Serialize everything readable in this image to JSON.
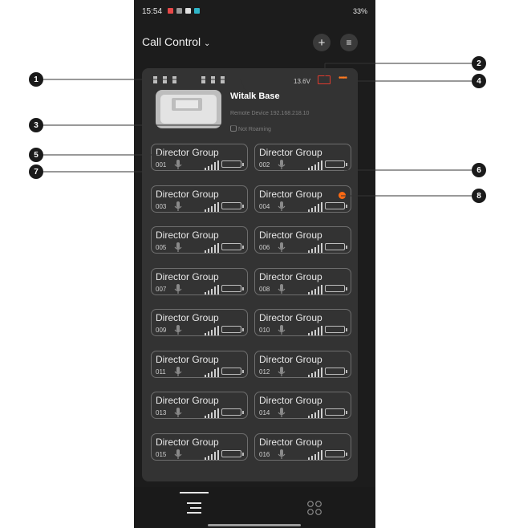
{
  "status_bar": {
    "time": "15:54",
    "right_text": "33%"
  },
  "header": {
    "title": "Call Control",
    "chevron": "chevron-down-icon",
    "add_icon": "plus-icon",
    "menu_icon": "menu-icon"
  },
  "base": {
    "voltage": "13.6V",
    "name": "Witalk Base",
    "remote_device": "Remote Device 192.168.218.10",
    "roaming": "Not Roaming",
    "more_dots": "••••"
  },
  "groups": [
    {
      "title": "Director Group",
      "num": "001"
    },
    {
      "title": "Director Group",
      "num": "002"
    },
    {
      "title": "Director Group",
      "num": "003"
    },
    {
      "title": "Director Group",
      "num": "004"
    },
    {
      "title": "Director Group",
      "num": "005"
    },
    {
      "title": "Director Group",
      "num": "006"
    },
    {
      "title": "Director Group",
      "num": "007"
    },
    {
      "title": "Director Group",
      "num": "008"
    },
    {
      "title": "Director Group",
      "num": "009"
    },
    {
      "title": "Director Group",
      "num": "010"
    },
    {
      "title": "Director Group",
      "num": "011"
    },
    {
      "title": "Director Group",
      "num": "012"
    },
    {
      "title": "Director Group",
      "num": "013"
    },
    {
      "title": "Director Group",
      "num": "014"
    },
    {
      "title": "Director Group",
      "num": "015"
    },
    {
      "title": "Director Group",
      "num": "016"
    }
  ],
  "callouts": [
    "1",
    "2",
    "3",
    "4",
    "5",
    "6",
    "7",
    "8"
  ],
  "colors": {
    "accent": "#ff6a13",
    "warning": "#e23b2e",
    "panel": "#333333",
    "background": "#1c1c1c"
  }
}
